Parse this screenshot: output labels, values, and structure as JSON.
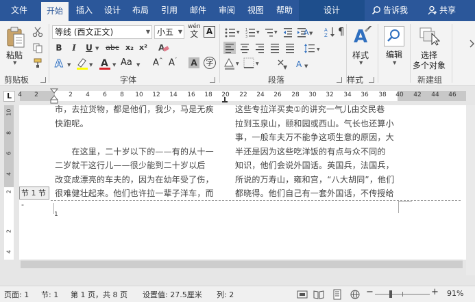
{
  "tabs": [
    "文件",
    "开始",
    "插入",
    "设计",
    "布局",
    "引用",
    "邮件",
    "审阅",
    "视图",
    "帮助"
  ],
  "context_tab": "设计",
  "tell_me": "告诉我",
  "share": "共享",
  "clipboard": {
    "paste": "粘贴",
    "group": "剪贴板"
  },
  "font": {
    "name": "等线 (西文正文)",
    "size": "小五",
    "wen": "wén",
    "bold": "B",
    "italic": "I",
    "underline": "U",
    "strike": "abc",
    "sub": "x₂",
    "sup": "x²",
    "color_a": "A",
    "case": "Aa",
    "grow": "A^",
    "shrink": "A˅",
    "clear": "A",
    "group": "字体"
  },
  "paragraph": {
    "group": "段落"
  },
  "styles": {
    "label": "样式",
    "group": "样式"
  },
  "editing": {
    "label": "编辑"
  },
  "select": {
    "line1": "选择",
    "line2": "多个对象",
    "group": "新建组"
  },
  "ruler": {
    "ticks": [
      "4",
      "2",
      "2",
      "4",
      "6",
      "8",
      "10",
      "12",
      "14",
      "16",
      "18",
      "20",
      "22",
      "24",
      "26",
      "28",
      "30",
      "32",
      "34",
      "36",
      "38",
      "40",
      "42",
      "44",
      "46"
    ],
    "tab_selector": "L"
  },
  "vruler": [
    "10",
    "8",
    "6",
    "4",
    "2",
    "2",
    "4"
  ],
  "document": {
    "left_col": [
      "市，去拉货物，都是他们，我少，马是无疾",
      "快跑呢。",
      "",
      "　　在这里，二十岁以下的——有的从十一",
      "二岁就干这行儿——很少能到二十岁以后",
      "改变成漂亮的车夫的，因为在幼年受了伤，",
      "很难健壮起来。他们也许拉一辈子洋车，而"
    ],
    "right_col": [
      "这些专拉洋买卖①的讲究一气儿由交民巷",
      "拉到玉泉山，颐和园或西山。气长也还算小",
      "事，一般车夫万不能争这项生意的原因，大",
      "半还是因为这些吃洋饭的有点与众不同的",
      "知识，他们会说外国话。英国兵，法国兵，",
      "所说的万寿山，雍和宫，“八大胡同”，他们",
      "都晓得。他们自己有一套外国话，不传授给"
    ],
    "section_tag": "节 1 节 -",
    "page_number_text": "1"
  },
  "status": {
    "page": "页面: 1",
    "section": "节: 1",
    "pages": "第 1 页，共 8 页",
    "setting": "设置值: 27.5厘米",
    "column": "列: 2",
    "zoom": "91%"
  }
}
